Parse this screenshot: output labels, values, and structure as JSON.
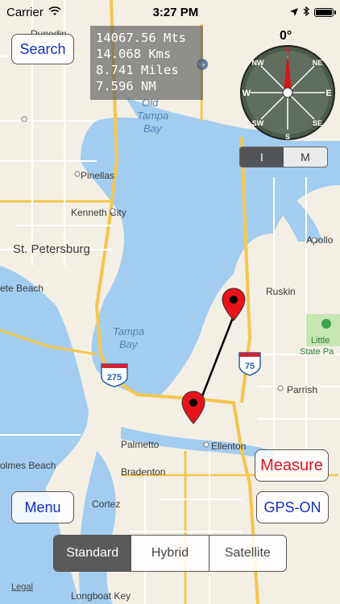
{
  "status_bar": {
    "carrier": "Carrier",
    "time": "3:27 PM"
  },
  "distance": {
    "meters": "14067.56 Mts",
    "kilometers": "14.068 Kms",
    "miles": "8.741 Miles",
    "nautical_miles": "7.596 NM"
  },
  "compass": {
    "heading": "0°",
    "labels": {
      "n": "N",
      "ne": "NE",
      "e": "E",
      "se": "SE",
      "s": "S",
      "sw": "SW",
      "w": "W",
      "nw": "NW"
    }
  },
  "buttons": {
    "search": "Search",
    "menu": "Menu",
    "measure": "Measure",
    "gps": "GPS-ON"
  },
  "unit_toggle": {
    "left": "I",
    "right": "M"
  },
  "map_type": {
    "options": [
      "Standard",
      "Hybrid",
      "Satellite"
    ],
    "selected": "Standard"
  },
  "map_labels": {
    "dunedin": "Dunedin",
    "old_tampa_bay_1": "Old",
    "old_tampa_bay_2": "Tampa",
    "old_tampa_bay_3": "Bay",
    "pinellas": "Pinellas",
    "kenneth_city": "Kenneth City",
    "st_petersburg": "St. Petersburg",
    "ete_beach": "ete Beach",
    "tampa_bay_1": "Tampa",
    "tampa_bay_2": "Bay",
    "ruskin": "Ruskin",
    "apollo": "Apollo",
    "little_manatee_1": "Little",
    "little_manatee_2": "State Pa",
    "parrish": "Parrish",
    "palmetto": "Palmetto",
    "ellenton": "Ellenton",
    "bradenton": "Bradenton",
    "holmes_beach": "olmes Beach",
    "cortez": "Cortez",
    "longboat_key": "Longboat Key",
    "hwy_275": "275",
    "hwy_75": "75"
  },
  "legal": "Legal",
  "colors": {
    "water": "#a3cdf0",
    "land": "#f4efe4",
    "road_major": "#f5c64e",
    "pin": "#e8121b",
    "button_text": "#1230c8",
    "measure_text": "#e0141e"
  }
}
